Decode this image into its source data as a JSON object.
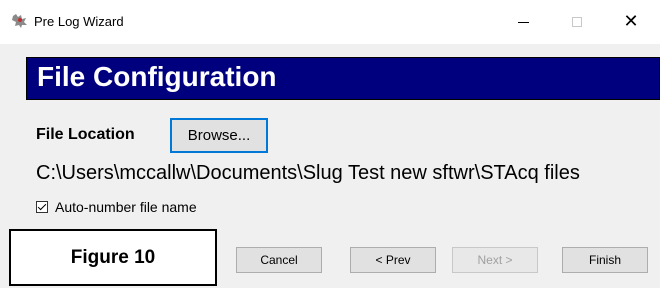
{
  "window": {
    "title": "Pre Log Wizard",
    "app_icon": "rooster-icon",
    "controls": {
      "minimize": "minimize-icon",
      "maximize": "maximize-icon",
      "close": "close-icon"
    }
  },
  "header": {
    "title": "File Configuration",
    "background": "#00007f"
  },
  "file_location": {
    "label": "File Location",
    "browse_label": "Browse...",
    "path": "C:\\Users\\mccallw\\Documents\\Slug Test new sftwr\\STAcq files"
  },
  "auto_number": {
    "label": "Auto-number file name",
    "checked": true
  },
  "figure_label": "Figure 10",
  "buttons": {
    "cancel": "Cancel",
    "prev": "< Prev",
    "next": "Next >",
    "finish": "Finish"
  }
}
